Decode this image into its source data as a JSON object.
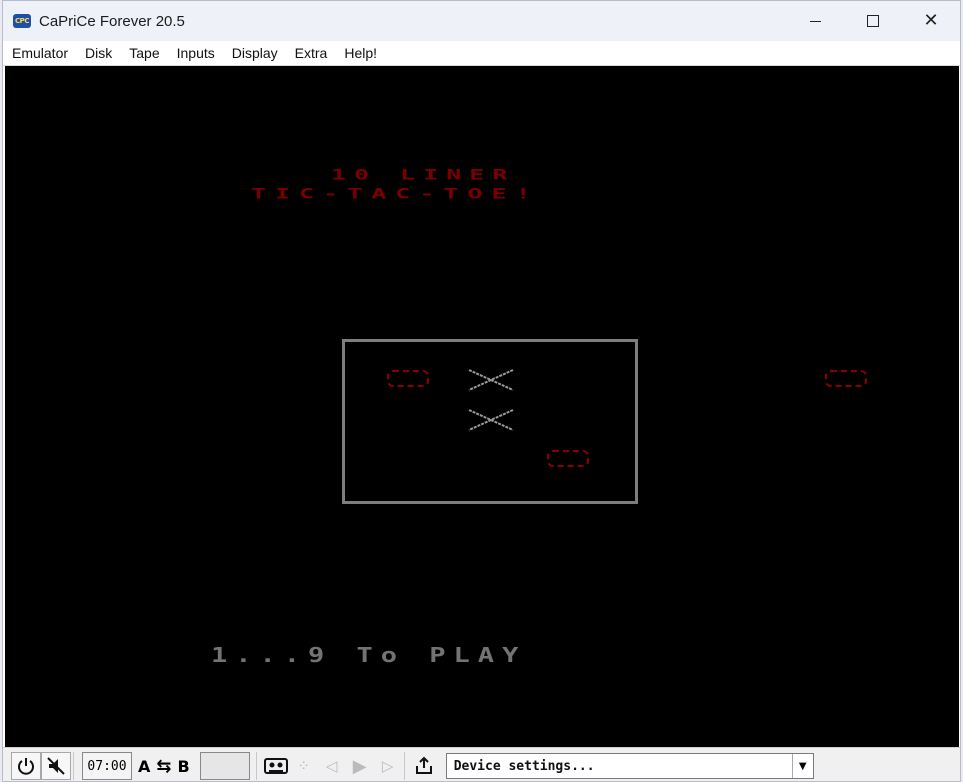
{
  "window": {
    "title": "CaPriCe Forever 20.5",
    "icon_text": "CPC"
  },
  "menu": [
    "Emulator",
    "Disk",
    "Tape",
    "Inputs",
    "Display",
    "Extra",
    "Help!"
  ],
  "game": {
    "title_line1": "10 LINER",
    "title_line2": "TIC-TAC-TOE!",
    "prompt": "1...9 To PLAY",
    "board_marks": [
      {
        "cell": 1,
        "mark": "O"
      },
      {
        "cell": 2,
        "mark": "X"
      },
      {
        "cell": 5,
        "mark": "X"
      },
      {
        "cell": 9,
        "mark": "O"
      }
    ],
    "next_mark": "O",
    "colors": {
      "title": "#7a0000",
      "o_mark": "#8a0000",
      "x_mark": "#9a9a9a",
      "board": "#7d7d7d",
      "prompt": "#737373",
      "background": "#000000"
    }
  },
  "statusbar": {
    "time": "07:00",
    "drive_a": "A",
    "drive_b": "B",
    "device_select": "Device settings...",
    "icons": [
      "power-icon",
      "mute-icon",
      "swap-icon",
      "cassette-icon",
      "rewind-icon",
      "back-icon",
      "play-icon",
      "forward-icon",
      "export-icon"
    ]
  }
}
